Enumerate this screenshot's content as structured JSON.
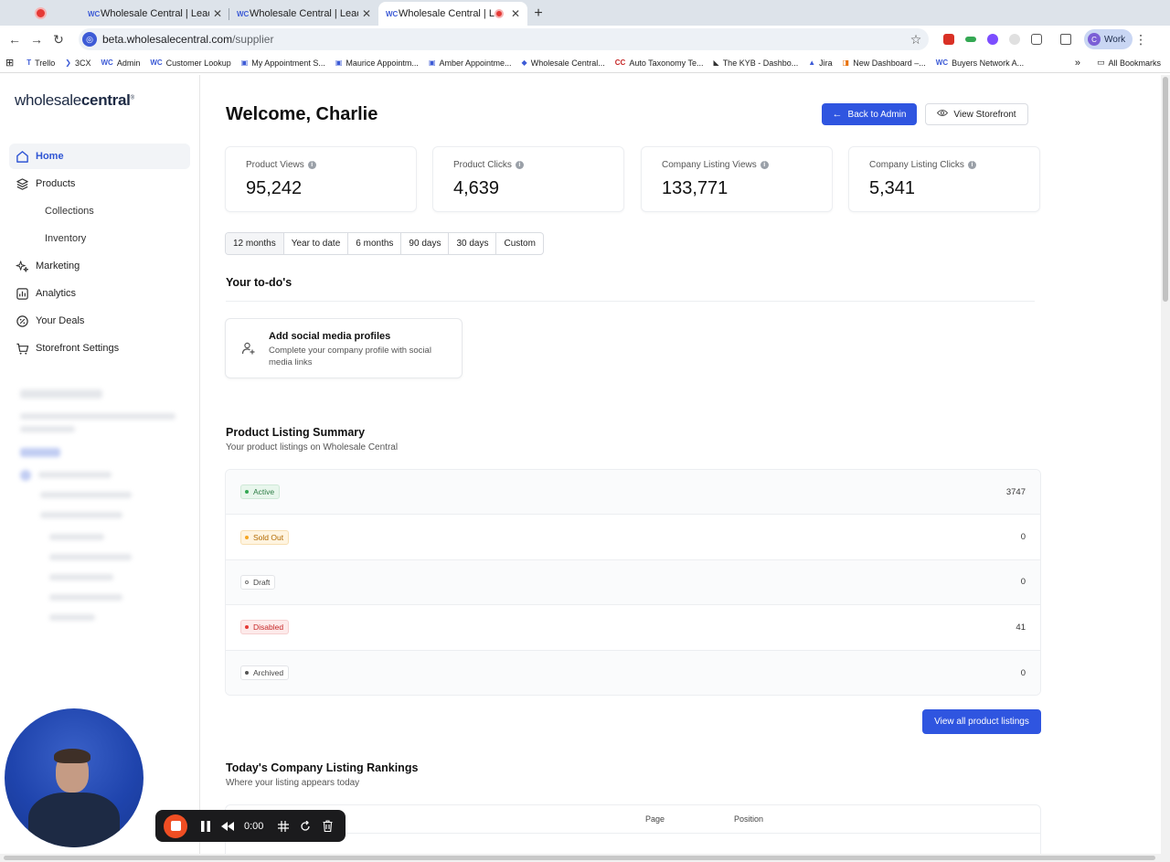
{
  "browser": {
    "tabs": [
      {
        "label": "Wholesale Central | Leading S",
        "favicon": "WC"
      },
      {
        "label": "Wholesale Central | Leading S",
        "favicon": "WC"
      },
      {
        "label": "Wholesale Central | Leadi",
        "favicon": "WC"
      }
    ],
    "url_host": "beta.wholesalecentral.com",
    "url_path": "/supplier",
    "profile_initial": "C",
    "profile_label": "Work",
    "bookmarks": [
      {
        "label": "Trello",
        "icon": "T"
      },
      {
        "label": "3CX",
        "icon": "❯"
      },
      {
        "label": "Admin",
        "icon": "WC"
      },
      {
        "label": "Customer Lookup",
        "icon": "WC"
      },
      {
        "label": "My Appointment S...",
        "icon": "▣"
      },
      {
        "label": "Maurice Appointm...",
        "icon": "▣"
      },
      {
        "label": "Amber Appointme...",
        "icon": "▣"
      },
      {
        "label": "Wholesale Central...",
        "icon": "◆"
      },
      {
        "label": "Auto Taxonomy Te...",
        "icon": "CC"
      },
      {
        "label": "The KYB - Dashbo...",
        "icon": "◣"
      },
      {
        "label": "Jira",
        "icon": "▲"
      },
      {
        "label": "New Dashboard –...",
        "icon": "◨"
      },
      {
        "label": "Buyers Network A...",
        "icon": "WC"
      }
    ],
    "bookmarks_overflow": "»",
    "all_bookmarks": "All Bookmarks"
  },
  "sidebar": {
    "logo_regular": "wholesale",
    "logo_bold": "central",
    "logo_mark": "®",
    "items": [
      {
        "label": "Home",
        "icon": "home-icon",
        "active": true
      },
      {
        "label": "Products",
        "icon": "layers-icon"
      },
      {
        "label": "Collections",
        "sub": true
      },
      {
        "label": "Inventory",
        "sub": true
      },
      {
        "label": "Marketing",
        "icon": "sparkle-icon"
      },
      {
        "label": "Analytics",
        "icon": "chart-icon"
      },
      {
        "label": "Your Deals",
        "icon": "percent-icon"
      },
      {
        "label": "Storefront Settings",
        "icon": "cart-icon"
      }
    ]
  },
  "main": {
    "title": "Welcome, Charlie",
    "back_button": "Back to Admin",
    "storefront_button": "View Storefront",
    "stats": [
      {
        "label": "Product Views",
        "value": "95,242"
      },
      {
        "label": "Product Clicks",
        "value": "4,639"
      },
      {
        "label": "Company Listing Views",
        "value": "133,771"
      },
      {
        "label": "Company Listing Clicks",
        "value": "5,341"
      }
    ],
    "ranges": [
      "12 months",
      "Year to date",
      "6 months",
      "90 days",
      "30 days",
      "Custom"
    ],
    "todos_title": "Your to-do's",
    "todo": {
      "title": "Add social media profiles",
      "description": "Complete your company profile with social media links"
    },
    "summary": {
      "title": "Product Listing Summary",
      "subtitle": "Your product listings on Wholesale Central",
      "rows": [
        {
          "status": "Active",
          "count": "3747",
          "bg": "#e8f6ec",
          "fg": "#2e7d46",
          "dot": "#34a853"
        },
        {
          "status": "Sold Out",
          "count": "0",
          "bg": "#fff4e0",
          "fg": "#b26a00",
          "dot": "#f5a623"
        },
        {
          "status": "Draft",
          "count": "0",
          "bg": "#ffffff",
          "fg": "#444444",
          "dot": "#ffffff"
        },
        {
          "status": "Disabled",
          "count": "41",
          "bg": "#fdeaea",
          "fg": "#c62828",
          "dot": "#e53935"
        },
        {
          "status": "Archived",
          "count": "0",
          "bg": "#ffffff",
          "fg": "#444444",
          "dot": "#555555"
        }
      ],
      "view_all": "View all product listings"
    },
    "rankings": {
      "title": "Today's Company Listing Rankings",
      "subtitle": "Where your listing appears today",
      "columns": [
        "Page",
        "Position"
      ]
    }
  },
  "recorder": {
    "time": "0:00"
  },
  "colors": {
    "accent": "#2f55e0",
    "active_nav": "#2f55d4"
  }
}
